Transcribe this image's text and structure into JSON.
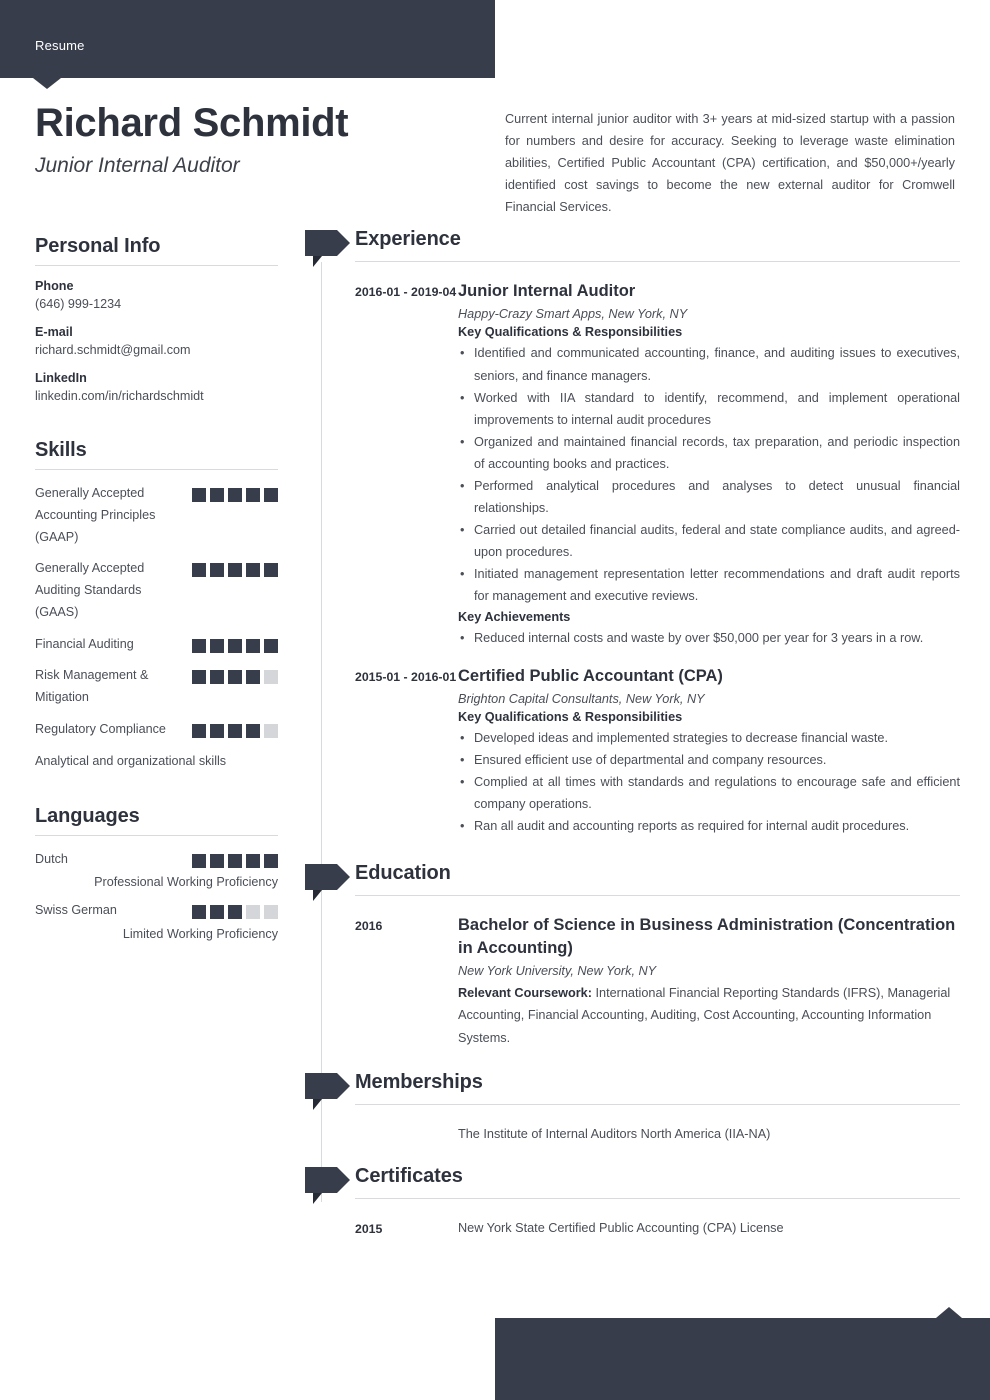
{
  "document": {
    "top_bar_label": "Resume",
    "accent_color": "#383d4b",
    "accent_dark": "#262a35",
    "text_color": "#4a4e57",
    "heading_color": "#2e323d",
    "square_empty_color": "#d4d6d9"
  },
  "header": {
    "full_name": "Richard Schmidt",
    "job_title": "Junior Internal Auditor",
    "summary": "Current internal junior auditor with 3+ years at mid-sized startup with a passion for numbers and desire for accuracy. Seeking to leverage waste elimination abilities, Certified Public Accountant (CPA) certification, and $50,000+/yearly identified cost savings to become the new external auditor for Cromwell Financial Services."
  },
  "personal_info": {
    "heading": "Personal Info",
    "items": [
      {
        "label": "Phone",
        "value": "(646) 999-1234"
      },
      {
        "label": "E-mail",
        "value": "richard.schmidt@gmail.com"
      },
      {
        "label": "LinkedIn",
        "value": "linkedin.com/in/richardschmidt"
      }
    ]
  },
  "skills": {
    "heading": "Skills",
    "max_rating": 5,
    "items": [
      {
        "label": "Generally Accepted Accounting Principles (GAAP)",
        "rating": 5
      },
      {
        "label": "Generally Accepted Auditing Standards (GAAS)",
        "rating": 5
      },
      {
        "label": "Financial Auditing",
        "rating": 5
      },
      {
        "label": "Risk Management & Mitigation",
        "rating": 4
      },
      {
        "label": "Regulatory Compliance",
        "rating": 4
      }
    ],
    "plain_items": [
      "Analytical and organizational skills"
    ]
  },
  "languages": {
    "heading": "Languages",
    "max_rating": 5,
    "items": [
      {
        "name": "Dutch",
        "rating": 5,
        "level": "Professional Working Proficiency"
      },
      {
        "name": "Swiss German",
        "rating": 3,
        "level": "Limited Working Proficiency"
      }
    ]
  },
  "experience": {
    "heading": "Experience",
    "entries": [
      {
        "date": "2016-01 - 2019-04",
        "title": "Junior Internal Auditor",
        "org": "Happy-Crazy Smart Apps, New York, NY",
        "sub1": "Key Qualifications & Responsibilities",
        "bullets1": [
          "Identified and communicated accounting, finance, and auditing issues to executives, seniors, and finance managers.",
          "Worked with IIA standard to identify, recommend, and implement operational improvements to internal audit procedures",
          "Organized and maintained financial records, tax preparation, and periodic inspection of accounting books and practices.",
          "Performed analytical procedures and analyses to detect unusual financial relationships.",
          "Carried out detailed financial audits, federal and state compliance audits, and agreed-upon procedures.",
          "Initiated management representation letter recommendations and draft audit reports for management and executive reviews."
        ],
        "sub2": "Key Achievements",
        "bullets2": [
          "Reduced internal costs and waste by over $50,000 per year for 3 years in a row."
        ]
      },
      {
        "date": "2015-01 - 2016-01",
        "title": "Certified Public Accountant (CPA)",
        "org": "Brighton Capital Consultants, New York, NY",
        "sub1": "Key Qualifications & Responsibilities",
        "bullets1": [
          "Developed ideas and implemented strategies to decrease financial waste.",
          "Ensured efficient use of departmental and company resources.",
          "Complied at all times with standards and regulations to encourage safe and efficient company operations.",
          "Ran all audit and accounting reports as required for internal audit procedures."
        ]
      }
    ]
  },
  "education": {
    "heading": "Education",
    "entries": [
      {
        "date": "2016",
        "title": "Bachelor of Science in Business Administration (Concentration in Accounting)",
        "org": "New York University, New York, NY",
        "coursework_label": "Relevant Coursework:",
        "coursework": " International Financial Reporting Standards (IFRS), Managerial Accounting, Financial Accounting, Auditing, Cost Accounting, Accounting Information Systems."
      }
    ]
  },
  "memberships": {
    "heading": "Memberships",
    "entries": [
      {
        "date": "",
        "text": "The Institute of Internal Auditors North America (IIA-NA)"
      }
    ]
  },
  "certificates": {
    "heading": "Certificates",
    "entries": [
      {
        "date": "2015",
        "text": "New York State Certified Public Accounting (CPA) License"
      }
    ]
  }
}
